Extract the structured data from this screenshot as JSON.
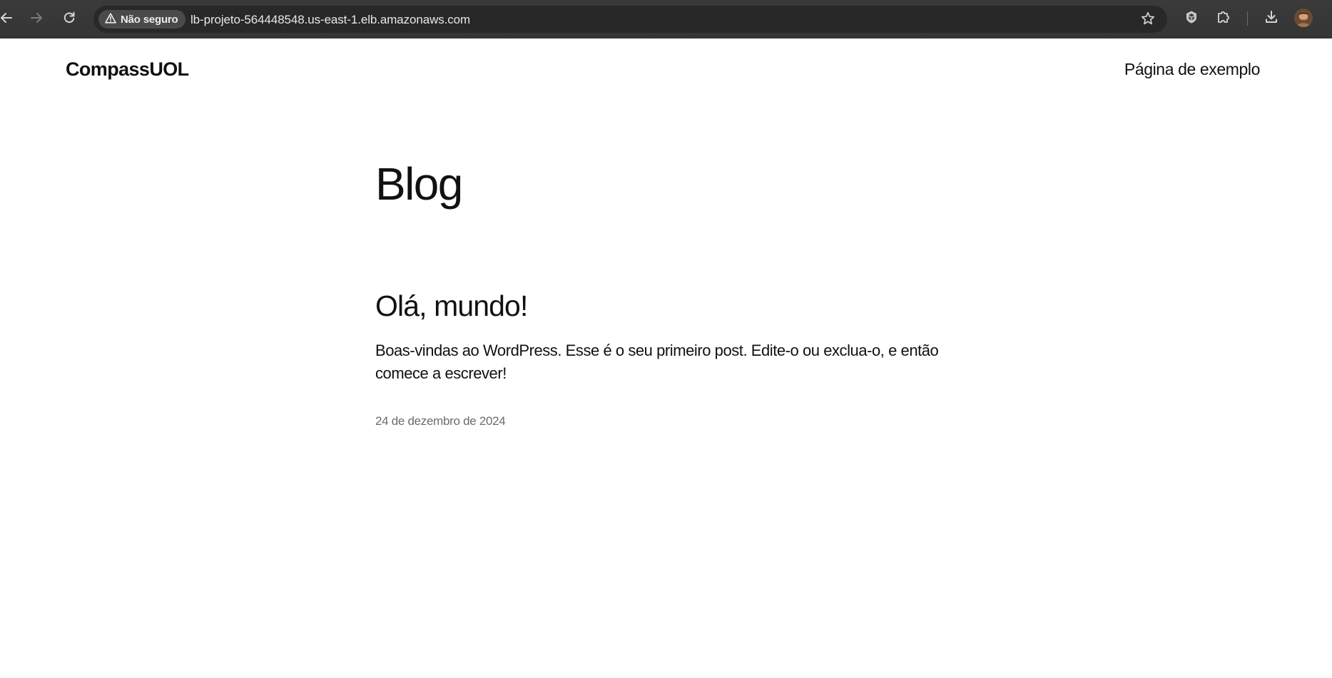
{
  "browser": {
    "security_label": "Não seguro",
    "url": "lb-projeto-564448548.us-east-1.elb.amazonaws.com",
    "icons": {
      "back": "arrow-left-icon",
      "forward": "arrow-right-icon",
      "reload": "reload-icon",
      "security": "warning-triangle-icon",
      "bookmark": "star-icon",
      "extension_1": "shield-extension-icon",
      "extensions": "puzzle-icon",
      "downloads": "download-icon",
      "profile": "avatar"
    },
    "colors": {
      "chrome_bg": "#3a3a3a",
      "omnibox_bg": "#282828",
      "chip_bg": "#4a4a4a",
      "text": "#e8e8e8"
    }
  },
  "site": {
    "title": "CompassUOL",
    "nav_items": [
      "Página de exemplo"
    ]
  },
  "main": {
    "heading": "Blog",
    "posts": [
      {
        "title": "Olá, mundo!",
        "excerpt": "Boas-vindas ao WordPress. Esse é o seu primeiro post. Edite-o ou exclua-o, e então comece a escrever!",
        "date": "24 de dezembro de 2024"
      }
    ]
  },
  "colors": {
    "page_bg": "#ffffff",
    "text": "#111111",
    "date_text": "#6b6b6b"
  }
}
